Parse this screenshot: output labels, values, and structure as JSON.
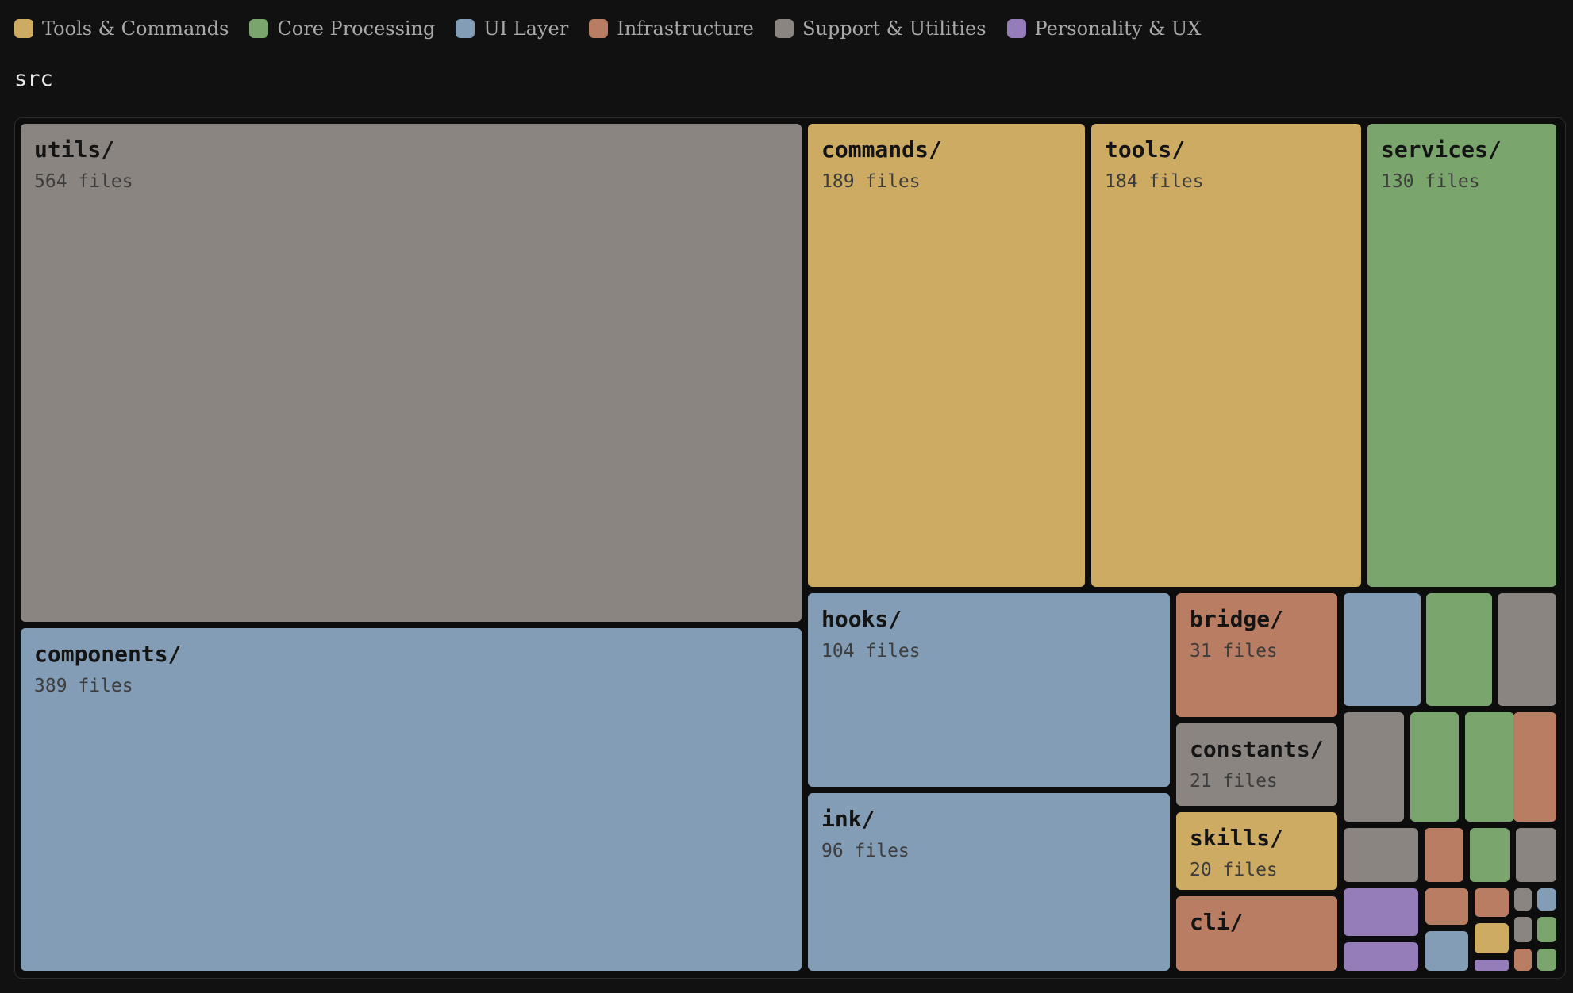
{
  "legend": [
    {
      "label": "Tools & Commands",
      "color": "#cdab62"
    },
    {
      "label": "Core Processing",
      "color": "#7aa56c"
    },
    {
      "label": "UI Layer",
      "color": "#829db5"
    },
    {
      "label": "Infrastructure",
      "color": "#b97d63"
    },
    {
      "label": "Support & Utilities",
      "color": "#8a8580"
    },
    {
      "label": "Personality & UX",
      "color": "#957dba"
    }
  ],
  "chart_data": {
    "type": "treemap",
    "root": "src",
    "count_unit": "files",
    "nodes": [
      {
        "name": "utils/",
        "files": 564,
        "category": "Support & Utilities"
      },
      {
        "name": "components/",
        "files": 389,
        "category": "UI Layer"
      },
      {
        "name": "commands/",
        "files": 189,
        "category": "Tools & Commands"
      },
      {
        "name": "tools/",
        "files": 184,
        "category": "Tools & Commands"
      },
      {
        "name": "services/",
        "files": 130,
        "category": "Core Processing"
      },
      {
        "name": "hooks/",
        "files": 104,
        "category": "UI Layer"
      },
      {
        "name": "ink/",
        "files": 96,
        "category": "UI Layer"
      },
      {
        "name": "bridge/",
        "files": 31,
        "category": "Infrastructure"
      },
      {
        "name": "constants/",
        "files": 21,
        "category": "Support & Utilities"
      },
      {
        "name": "skills/",
        "files": 20,
        "category": "Tools & Commands"
      },
      {
        "name": "cli/",
        "files": 19,
        "category": "Infrastructure",
        "count_shown": false
      },
      {
        "name": "",
        "files": 14,
        "category": "UI Layer",
        "label_shown": false
      },
      {
        "name": "",
        "files": 12,
        "category": "Core Processing",
        "label_shown": false
      },
      {
        "name": "",
        "files": 10,
        "category": "Support & Utilities",
        "label_shown": false
      },
      {
        "name": "",
        "files": 12,
        "category": "Support & Utilities",
        "label_shown": false
      },
      {
        "name": "",
        "files": 11,
        "category": "Core Processing",
        "label_shown": false
      },
      {
        "name": "",
        "files": 10,
        "category": "Core Processing",
        "label_shown": false
      },
      {
        "name": "",
        "files": 10,
        "category": "Infrastructure",
        "label_shown": false
      },
      {
        "name": "",
        "files": 7,
        "category": "Support & Utilities",
        "label_shown": false
      },
      {
        "name": "",
        "files": 5,
        "category": "Infrastructure",
        "label_shown": false
      },
      {
        "name": "",
        "files": 5,
        "category": "Core Processing",
        "label_shown": false
      },
      {
        "name": "",
        "files": 5,
        "category": "Support & Utilities",
        "label_shown": false
      },
      {
        "name": "",
        "files": 6,
        "category": "Personality & UX",
        "label_shown": false
      },
      {
        "name": "",
        "files": 6,
        "category": "Personality & UX",
        "label_shown": false
      },
      {
        "name": "",
        "files": 4,
        "category": "Infrastructure",
        "label_shown": false
      },
      {
        "name": "",
        "files": 4,
        "category": "UI Layer",
        "label_shown": false
      },
      {
        "name": "",
        "files": 3,
        "category": "Infrastructure",
        "label_shown": false
      },
      {
        "name": "",
        "files": 3,
        "category": "Tools & Commands",
        "label_shown": false
      },
      {
        "name": "",
        "files": 1,
        "category": "Personality & UX",
        "label_shown": false
      },
      {
        "name": "",
        "files": 2,
        "category": "Support & Utilities",
        "label_shown": false
      },
      {
        "name": "",
        "files": 2,
        "category": "UI Layer",
        "label_shown": false
      },
      {
        "name": "",
        "files": 2,
        "category": "Support & Utilities",
        "label_shown": false
      },
      {
        "name": "",
        "files": 2,
        "category": "Core Processing",
        "label_shown": false
      },
      {
        "name": "",
        "files": 2,
        "category": "Infrastructure",
        "label_shown": false
      },
      {
        "name": "",
        "files": 2,
        "category": "Core Processing",
        "label_shown": false
      }
    ]
  }
}
